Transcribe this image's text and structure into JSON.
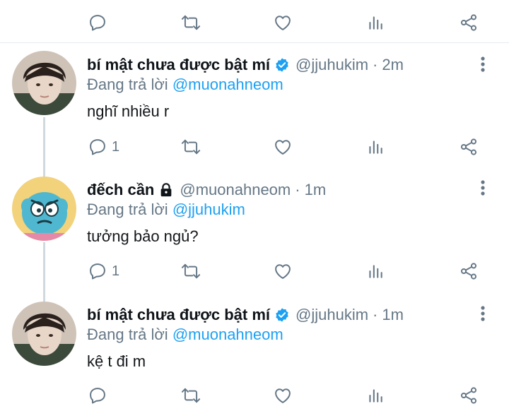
{
  "colors": {
    "accent": "#1da1f2",
    "secondary_text": "#657786",
    "icon": "#657786",
    "divider": "#e6ecf0",
    "thread_line": "#cfd9de"
  },
  "top_actions": {
    "icons": [
      "comment-icon",
      "retweet-icon",
      "like-icon",
      "analytics-icon",
      "share-icon"
    ]
  },
  "tweets": [
    {
      "display_name": "bí mật chưa được bật mí",
      "badge": "verified-badge-icon",
      "handle": "@jjuhukim",
      "separator": "·",
      "time": "2m",
      "replying_prefix": "Đang trả lời",
      "replying_to": "@muonahneom",
      "text": "nghĩ nhiều r",
      "reply_count": "1"
    },
    {
      "display_name": "đếch cần",
      "badge": "lock-icon",
      "handle": "@muonahneom",
      "separator": "·",
      "time": "1m",
      "replying_prefix": "Đang trả lời",
      "replying_to": "@jjuhukim",
      "text": "tưởng bảo ngủ?",
      "reply_count": "1"
    },
    {
      "display_name": "bí mật chưa được bật mí",
      "badge": "verified-badge-icon",
      "handle": "@jjuhukim",
      "separator": "·",
      "time": "1m",
      "replying_prefix": "Đang trả lời",
      "replying_to": "@muonahneom",
      "text": "kệ t đi m",
      "reply_count": ""
    }
  ]
}
